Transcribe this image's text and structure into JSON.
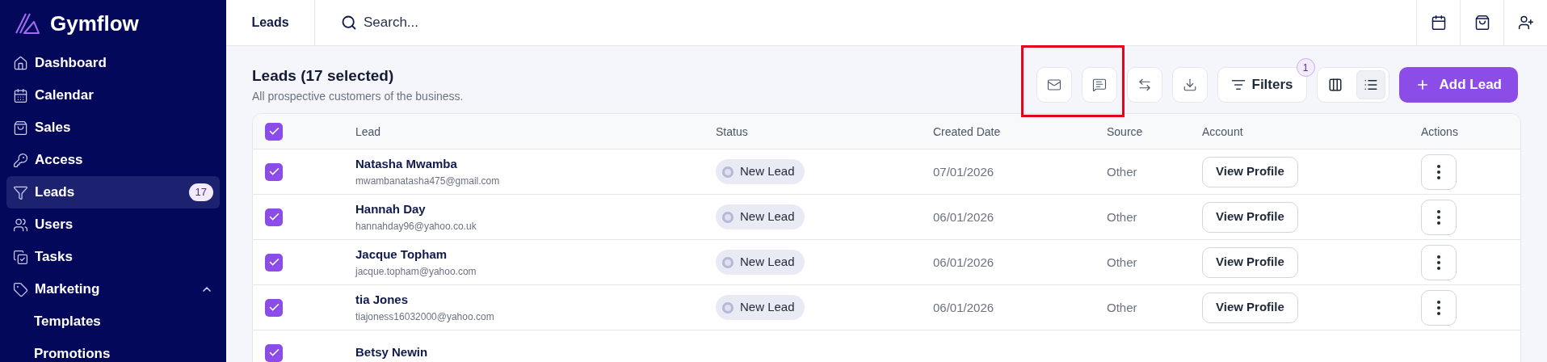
{
  "brand": {
    "name": "Gymflow"
  },
  "sidebar": {
    "items": [
      {
        "kind": "dashboard",
        "label": "Dashboard",
        "selected": false
      },
      {
        "kind": "calendar",
        "label": "Calendar",
        "selected": false
      },
      {
        "kind": "sales",
        "label": "Sales",
        "selected": false
      },
      {
        "kind": "access",
        "label": "Access",
        "selected": false
      },
      {
        "kind": "leads",
        "label": "Leads",
        "selected": true,
        "badge": "17"
      },
      {
        "kind": "users",
        "label": "Users",
        "selected": false
      },
      {
        "kind": "tasks",
        "label": "Tasks",
        "selected": false
      },
      {
        "kind": "marketing",
        "label": "Marketing",
        "selected": false,
        "expanded": true,
        "children": [
          {
            "label": "Templates",
            "selected": false
          },
          {
            "label": "Promotions",
            "selected": false
          }
        ]
      }
    ]
  },
  "topbar": {
    "page_title": "Leads",
    "search": {
      "placeholder": "Search..."
    },
    "icon_buttons": [
      {
        "kind": "calendar"
      },
      {
        "kind": "bag"
      },
      {
        "kind": "add-user"
      }
    ]
  },
  "header": {
    "title": "Leads (17 selected)",
    "subtitle": "All prospective customers of the business."
  },
  "toolbar": {
    "icon_buttons": [
      {
        "kind": "mail",
        "highlighted": true
      },
      {
        "kind": "message",
        "highlighted": true
      },
      {
        "kind": "swap",
        "highlighted": false
      },
      {
        "kind": "download",
        "highlighted": false
      }
    ],
    "filters": {
      "label": "Filters",
      "count": "1"
    },
    "views": [
      {
        "kind": "board",
        "selected": false
      },
      {
        "kind": "list",
        "selected": true
      }
    ],
    "add_button": {
      "label": "Add Lead"
    }
  },
  "table": {
    "select_all": {
      "checked": true
    },
    "columns": [
      "Lead",
      "Status",
      "Created Date",
      "Source",
      "Account",
      "Actions"
    ],
    "rows": [
      {
        "checked": true,
        "name": "Natasha Mwamba",
        "email": "mwambanatasha475@gmail.com",
        "status": "New Lead",
        "created": "07/01/2026",
        "source": "Other",
        "account": "View Profile"
      },
      {
        "checked": true,
        "name": "Hannah Day",
        "email": "hannahday96@yahoo.co.uk",
        "status": "New Lead",
        "created": "06/01/2026",
        "source": "Other",
        "account": "View Profile"
      },
      {
        "checked": true,
        "name": "Jacque Topham",
        "email": "jacque.topham@yahoo.com",
        "status": "New Lead",
        "created": "06/01/2026",
        "source": "Other",
        "account": "View Profile"
      },
      {
        "checked": true,
        "name": "tia Jones",
        "email": "tiajoness16032000@yahoo.com",
        "status": "New Lead",
        "created": "06/01/2026",
        "source": "Other",
        "account": "View Profile"
      },
      {
        "checked": true,
        "name": "Betsy Newin"
      }
    ]
  }
}
